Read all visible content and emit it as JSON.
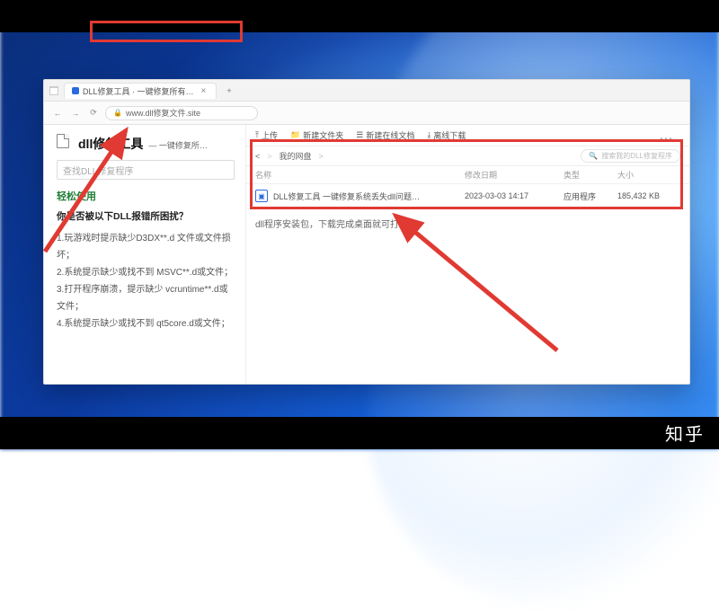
{
  "watermark": "知乎",
  "browser": {
    "tab_title": "DLL修复工具 · 一键修复所有…",
    "tab_close": "×",
    "newtab": "+",
    "nav": {
      "back": "←",
      "forward": "→",
      "reload": "⟳"
    },
    "address": "www.dll修复文件.site",
    "lock_icon": "🔒"
  },
  "sidebar": {
    "brand_title": "dll修复工具",
    "brand_sub": "— 一键修复所…",
    "search_placeholder": "查找DLL修复程序",
    "section": "轻松使用",
    "question": "你是否被以下DLL报错所困扰？",
    "issues": [
      "1.玩游戏时提示缺少D3DX**.d 文件或文件损坏；",
      "2.系统提示缺少或找不到 MSVC**.d或文件；",
      "3.打开程序崩溃，提示缺少 vcruntime**.d或文件；",
      "4.系统提示缺少或找不到 qt5core.d或文件；"
    ]
  },
  "disk": {
    "toolbar": {
      "upload": "上传",
      "newfolder": "新建文件夹",
      "newdoc": "新建在线文档",
      "download": "离线下载"
    },
    "toolbar_glyphs": {
      "upload": "⤒",
      "newfolder": "📁",
      "newdoc": "☰",
      "download": "⤓",
      "more": "…"
    },
    "path_back": "<",
    "path_fwd": ">",
    "path_label": "我的网盘",
    "path_chevron": ">",
    "search_placeholder": "搜索我的DLL修复程序",
    "search_icon": "🔍",
    "columns": {
      "name": "名称",
      "date": "修改日期",
      "type": "类型",
      "size": "大小"
    },
    "file": {
      "name": "DLL修复工具  一键修复系统丢失dll问题…",
      "date": "2023-03-03 14:17",
      "type": "应用程序",
      "size": "185,432 KB"
    },
    "note": "dll程序安装包，下载完成桌面就可打开"
  }
}
